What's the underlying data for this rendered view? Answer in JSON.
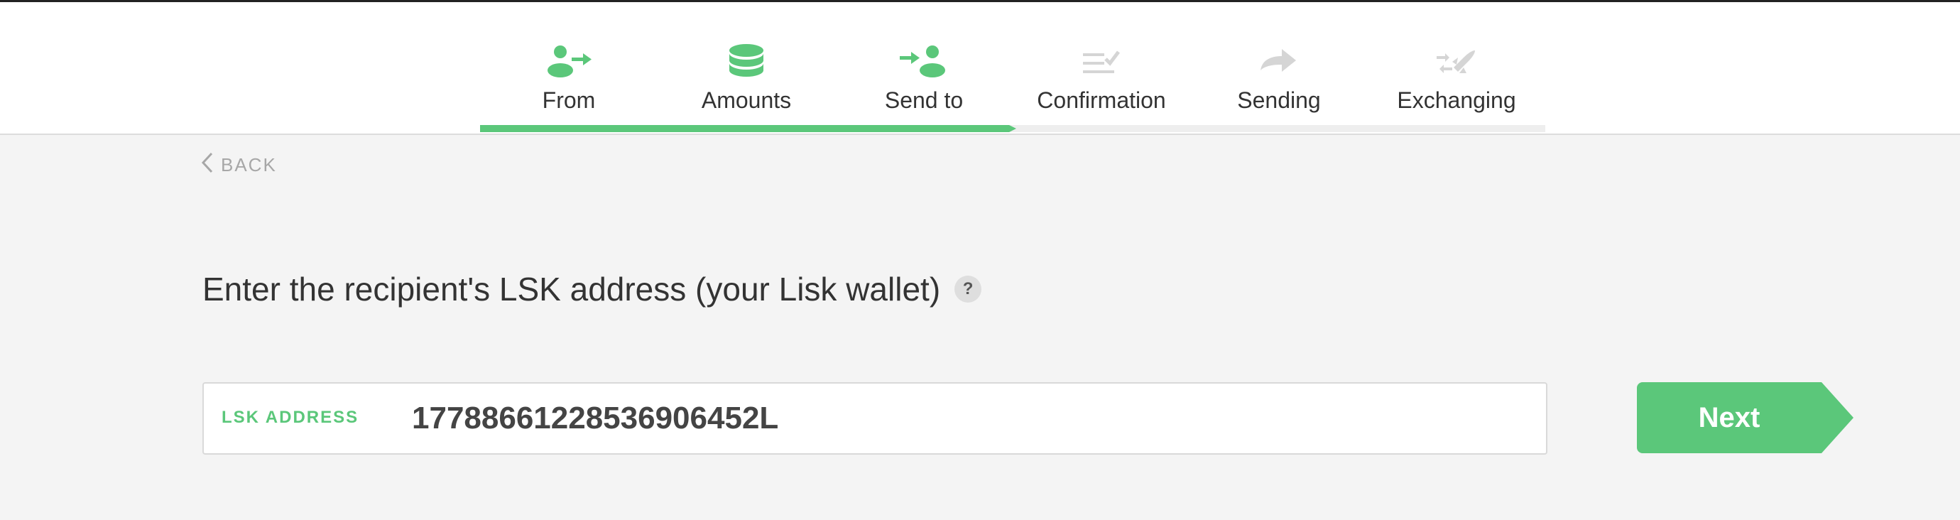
{
  "steps": [
    {
      "label": "From",
      "icon": "person-send-icon",
      "state": "done"
    },
    {
      "label": "Amounts",
      "icon": "coins-stack-icon",
      "state": "done"
    },
    {
      "label": "Send to",
      "icon": "person-receive-icon",
      "state": "active"
    },
    {
      "label": "Confirmation",
      "icon": "checklist-icon",
      "state": "pending"
    },
    {
      "label": "Sending",
      "icon": "arrow-right-icon",
      "state": "pending"
    },
    {
      "label": "Exchanging",
      "icon": "rocket-icon",
      "state": "pending"
    }
  ],
  "progress": {
    "completed_fraction": 0.5
  },
  "back_label": "BACK",
  "question": "Enter the recipient's LSK address (your Lisk wallet)",
  "help_label": "?",
  "address_field": {
    "label": "LSK ADDRESS",
    "value": "17788661228536906452L"
  },
  "next_label": "Next",
  "colors": {
    "accent": "#5bc77a",
    "inactive": "#d5d5d5",
    "background": "#f4f4f4"
  }
}
